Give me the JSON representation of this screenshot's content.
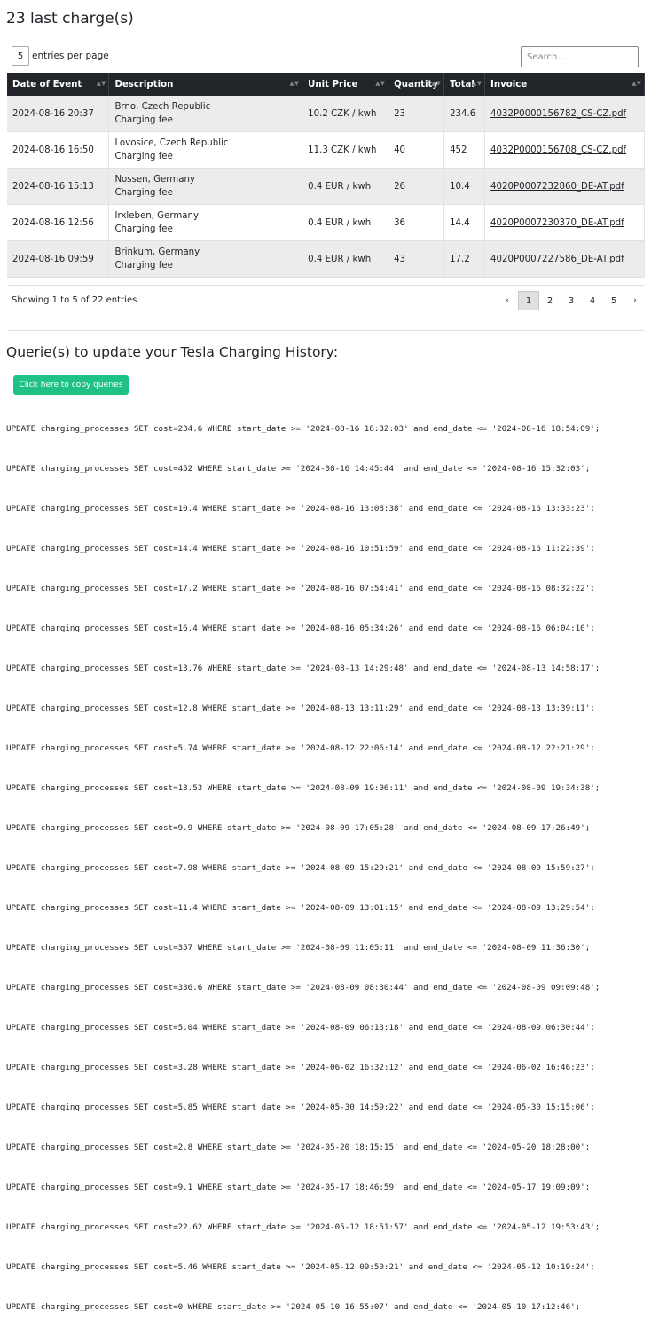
{
  "page_title": "23 last charge(s)",
  "length_menu": {
    "value": "5",
    "label": "entries per page"
  },
  "search": {
    "placeholder": "Search..."
  },
  "table": {
    "headers": [
      "Date of Event",
      "Description",
      "Unit Price",
      "Quantity",
      "Total",
      "Invoice"
    ],
    "rows": [
      {
        "date": "2024-08-16 20:37",
        "location": "Brno, Czech Republic",
        "type": "Charging fee",
        "unit_price": "10.2 CZK / kwh",
        "quantity": "23",
        "total": "234.6",
        "invoice": "4032P0000156782_CS-CZ.pdf"
      },
      {
        "date": "2024-08-16 16:50",
        "location": "Lovosice, Czech Republic",
        "type": "Charging fee",
        "unit_price": "11.3 CZK / kwh",
        "quantity": "40",
        "total": "452",
        "invoice": "4032P0000156708_CS-CZ.pdf"
      },
      {
        "date": "2024-08-16 15:13",
        "location": "Nossen, Germany",
        "type": "Charging fee",
        "unit_price": "0.4 EUR / kwh",
        "quantity": "26",
        "total": "10.4",
        "invoice": "4020P0007232860_DE-AT.pdf"
      },
      {
        "date": "2024-08-16 12:56",
        "location": "Irxleben, Germany",
        "type": "Charging fee",
        "unit_price": "0.4 EUR / kwh",
        "quantity": "36",
        "total": "14.4",
        "invoice": "4020P0007230370_DE-AT.pdf"
      },
      {
        "date": "2024-08-16 09:59",
        "location": "Brinkum, Germany",
        "type": "Charging fee",
        "unit_price": "0.4 EUR / kwh",
        "quantity": "43",
        "total": "17.2",
        "invoice": "4020P0007227586_DE-AT.pdf"
      }
    ]
  },
  "info": "Showing 1 to 5 of 22 entries",
  "pagination": {
    "prev": "‹",
    "pages": [
      "1",
      "2",
      "3",
      "4",
      "5"
    ],
    "next": "›",
    "active": "1"
  },
  "queries_title": "Querie(s) to update your Tesla Charging History:",
  "copy_button": "Click here to copy queries",
  "queries": [
    "UPDATE charging_processes SET cost=234.6 WHERE start_date >= '2024-08-16 18:32:03' and end_date <= '2024-08-16 18:54:09';",
    "UPDATE charging_processes SET cost=452 WHERE start_date >= '2024-08-16 14:45:44' and end_date <= '2024-08-16 15:32:03';",
    "UPDATE charging_processes SET cost=10.4 WHERE start_date >= '2024-08-16 13:08:38' and end_date <= '2024-08-16 13:33:23';",
    "UPDATE charging_processes SET cost=14.4 WHERE start_date >= '2024-08-16 10:51:59' and end_date <= '2024-08-16 11:22:39';",
    "UPDATE charging_processes SET cost=17.2 WHERE start_date >= '2024-08-16 07:54:41' and end_date <= '2024-08-16 08:32:22';",
    "UPDATE charging_processes SET cost=16.4 WHERE start_date >= '2024-08-16 05:34:26' and end_date <= '2024-08-16 06:04:10';",
    "UPDATE charging_processes SET cost=13.76 WHERE start_date >= '2024-08-13 14:29:48' and end_date <= '2024-08-13 14:58:17';",
    "UPDATE charging_processes SET cost=12.8 WHERE start_date >= '2024-08-13 13:11:29' and end_date <= '2024-08-13 13:39:11';",
    "UPDATE charging_processes SET cost=5.74 WHERE start_date >= '2024-08-12 22:06:14' and end_date <= '2024-08-12 22:21:29';",
    "UPDATE charging_processes SET cost=13.53 WHERE start_date >= '2024-08-09 19:06:11' and end_date <= '2024-08-09 19:34:38';",
    "UPDATE charging_processes SET cost=9.9 WHERE start_date >= '2024-08-09 17:05:28' and end_date <= '2024-08-09 17:26:49';",
    "UPDATE charging_processes SET cost=7.98 WHERE start_date >= '2024-08-09 15:29:21' and end_date <= '2024-08-09 15:59:27';",
    "UPDATE charging_processes SET cost=11.4 WHERE start_date >= '2024-08-09 13:01:15' and end_date <= '2024-08-09 13:29:54';",
    "UPDATE charging_processes SET cost=357 WHERE start_date >= '2024-08-09 11:05:11' and end_date <= '2024-08-09 11:36:30';",
    "UPDATE charging_processes SET cost=336.6 WHERE start_date >= '2024-08-09 08:30:44' and end_date <= '2024-08-09 09:09:48';",
    "UPDATE charging_processes SET cost=5.04 WHERE start_date >= '2024-08-09 06:13:18' and end_date <= '2024-08-09 06:30:44';",
    "UPDATE charging_processes SET cost=3.28 WHERE start_date >= '2024-06-02 16:32:12' and end_date <= '2024-06-02 16:46:23';",
    "UPDATE charging_processes SET cost=5.85 WHERE start_date >= '2024-05-30 14:59:22' and end_date <= '2024-05-30 15:15:06';",
    "UPDATE charging_processes SET cost=2.8 WHERE start_date >= '2024-05-20 18:15:15' and end_date <= '2024-05-20 18:28:00';",
    "UPDATE charging_processes SET cost=9.1 WHERE start_date >= '2024-05-17 18:46:59' and end_date <= '2024-05-17 19:09:09';",
    "UPDATE charging_processes SET cost=22.62 WHERE start_date >= '2024-05-12 18:51:57' and end_date <= '2024-05-12 19:53:43';",
    "UPDATE charging_processes SET cost=5.46 WHERE start_date >= '2024-05-12 09:50:21' and end_date <= '2024-05-12 10:19:24';",
    "UPDATE charging_processes SET cost=0 WHERE start_date >= '2024-05-10 16:55:07' and end_date <= '2024-05-10 17:12:46';"
  ]
}
